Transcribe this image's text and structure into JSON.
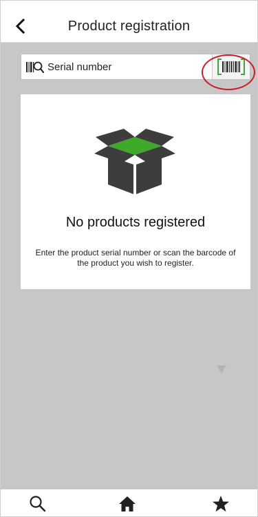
{
  "header": {
    "title": "Product registration",
    "back_icon": "chevron-left-icon"
  },
  "search": {
    "placeholder": "Serial number",
    "icon": "barcode-search-icon",
    "scan_icon": "barcode-scan-icon"
  },
  "empty_state": {
    "icon": "open-box-icon",
    "title": "No products registered",
    "description": "Enter the product serial number or scan the barcode of the product you wish to register."
  },
  "tabbar": {
    "items": [
      {
        "icon": "search-icon"
      },
      {
        "icon": "home-icon"
      },
      {
        "icon": "star-icon"
      }
    ]
  },
  "colors": {
    "content_bg": "#c7c7c7",
    "box_dark": "#3d3d3d",
    "box_green": "#3faa2a",
    "scan_green": "#39a83a",
    "highlight_ring": "#c81e2a"
  }
}
